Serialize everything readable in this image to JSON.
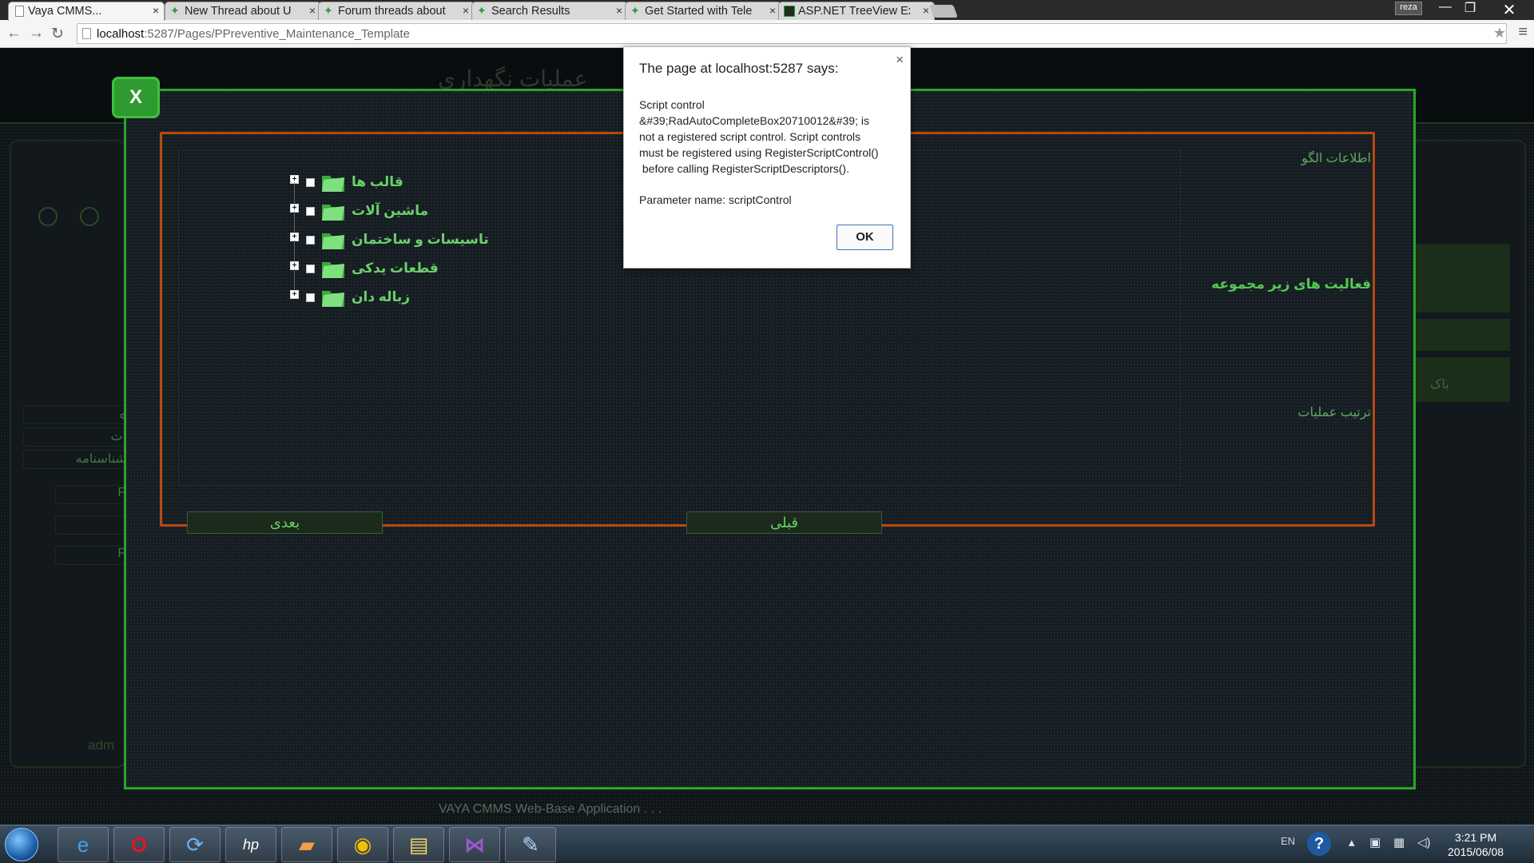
{
  "browser": {
    "tabs": [
      {
        "label": "Vaya CMMS...",
        "icon": "page-icon",
        "active": true
      },
      {
        "label": "New Thread about U",
        "icon": "telerik-icon"
      },
      {
        "label": "Forum threads about",
        "icon": "telerik-icon"
      },
      {
        "label": "Search Results",
        "icon": "telerik-icon"
      },
      {
        "label": "Get Started with Tele",
        "icon": "telerik-icon"
      },
      {
        "label": "ASP.NET TreeView Ex",
        "icon": "aspnet-icon"
      }
    ],
    "user": "reza",
    "url_host": "localhost",
    "url_path": ":5287/Pages/PPreventive_Maintenance_Template"
  },
  "page": {
    "header_title": "عملیات نگهداری",
    "left_sidebar_items": [
      "ه",
      "ات",
      "شناسنامه",
      "P",
      "",
      "P"
    ],
    "user_label": "adm",
    "right_sidebar_text": "باک",
    "footer": "VAYA CMMS Web-Base Application . . ."
  },
  "modal": {
    "close_label": "X",
    "side_labels": {
      "template_info": "اطلاعات الگو",
      "sub_activities": "فعالیت های زیر مجموعه",
      "operation_order": "ترتیب عملیات"
    },
    "tree_nodes": [
      {
        "label": "قالب ها"
      },
      {
        "label": "ماشین آلات"
      },
      {
        "label": "تاسیسات و ساختمان"
      },
      {
        "label": "قطعات یدکی"
      },
      {
        "label": "زباله دان"
      }
    ],
    "next_button": "بعدی",
    "prev_button": "قبلی"
  },
  "dialog": {
    "title": "The page at localhost:5287 says:",
    "message": "Script control\n&#39;RadAutoCompleteBox20710012&#39; is\nnot a registered script control. Script controls\nmust be registered using RegisterScriptControl()\n before calling RegisterScriptDescriptors().",
    "parameter": "Parameter name: scriptControl",
    "ok_label": "OK"
  },
  "taskbar": {
    "apps": [
      "internet-explorer-icon",
      "opera-icon",
      "refresh-sync-icon",
      "hp-icon",
      "app-icon",
      "chrome-icon",
      "file-explorer-icon",
      "visual-studio-icon",
      "paint-icon"
    ],
    "language": "EN",
    "time": "3:21 PM",
    "date": "2015/06/08"
  },
  "colors": {
    "accent_green": "#2aa52a",
    "tree_text": "#6ad06a",
    "inner_border": "#b84a10"
  }
}
